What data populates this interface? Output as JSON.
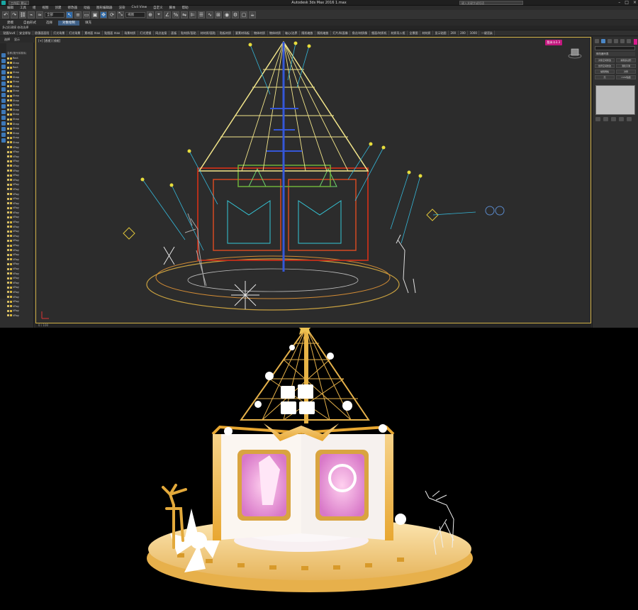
{
  "window": {
    "title": "Autodesk 3ds Max 2016    1.max",
    "search_placeholder": "键入关键字或短语",
    "workspace": "工作区: 默认"
  },
  "menu": [
    "编辑",
    "工具",
    "组",
    "视图",
    "创建",
    "修改器",
    "动画",
    "图形编辑器",
    "渲染",
    "Civil View",
    "自定义",
    "脚本",
    "帮助"
  ],
  "toolbar": {
    "selection_filter": "全部",
    "ref_coord": "视图"
  },
  "ribbon": {
    "tabs": [
      "建模",
      "自由形式",
      "选择",
      "对象绘制",
      "填充"
    ],
    "active": "对象绘制"
  },
  "scene_bar": "多边形建模    修改选择",
  "plugin_bar": [
    "贴图/uvd",
    "安全样存",
    "欧惠面面阳",
    "灯光场景",
    "灯光场景",
    "素材面 max",
    "贴图面 max",
    "场景材质",
    "灯光透镜",
    "网点连接",
    "面板",
    "贴材质/面贴",
    "材材质/面贴",
    "贴板材质",
    "要素材场板",
    "物体材质",
    "物体材质",
    "轴心/边界",
    "随机缩放",
    "随机缩放",
    "灯片/料面像",
    "角点/材质像",
    "细面/材质机",
    "材质导入框",
    "全景图",
    "材材质",
    "显示贴图",
    "200",
    "200",
    "1000",
    "一键渲染"
  ],
  "explorer": {
    "tabs": [
      "选择",
      "显示"
    ],
    "header": "名称(按升序排序)",
    "items": [
      "Rect",
      "Shap",
      "Rect",
      "Shap",
      "Shap",
      "Shap",
      "Shap",
      "Shap",
      "Shap",
      "Shap",
      "Shap",
      "Shap",
      "Shap",
      "Shap",
      "Shap",
      "Shap",
      "Shap",
      "Shap",
      "Shap",
      "VRay",
      "VRay",
      "VRay",
      "VRay",
      "VRay",
      "VRay",
      "VRay",
      "VRay",
      "VRay",
      "VRay",
      "VRay",
      "VRay",
      "VRay",
      "VRay",
      "VRay",
      "VRay",
      "VRay",
      "VRay",
      "VRay",
      "VRay",
      "VRay",
      "VRay",
      "VRay",
      "VRay",
      "VRay",
      "VRay",
      "VRay",
      "VRay",
      "VRay",
      "VRay",
      "VRay",
      "VRay",
      "VRay",
      "VRay",
      "VRay",
      "VRay",
      "VRay"
    ]
  },
  "viewport": {
    "label": "[+] [透视] [线框]",
    "badge": "酷米卡3.3"
  },
  "command_panel": {
    "object_name": "",
    "modifier_list": "修改器列表",
    "buttons": [
      "对象空间修改",
      "编辑多边形",
      "世界空间修改",
      "涡轮平滑",
      "编辑网格",
      "对称",
      "壳",
      "UVW贴图"
    ]
  },
  "timeline": "0 / 100",
  "colors": {
    "frame_gold": "#d0b047",
    "wire_yellow": "#f2e58a",
    "wire_blue": "#3557d8",
    "wire_red": "#c2361b",
    "wire_cyan": "#35c7d8",
    "render_gold": "#e8a731",
    "badge_pink": "#c2187e"
  }
}
